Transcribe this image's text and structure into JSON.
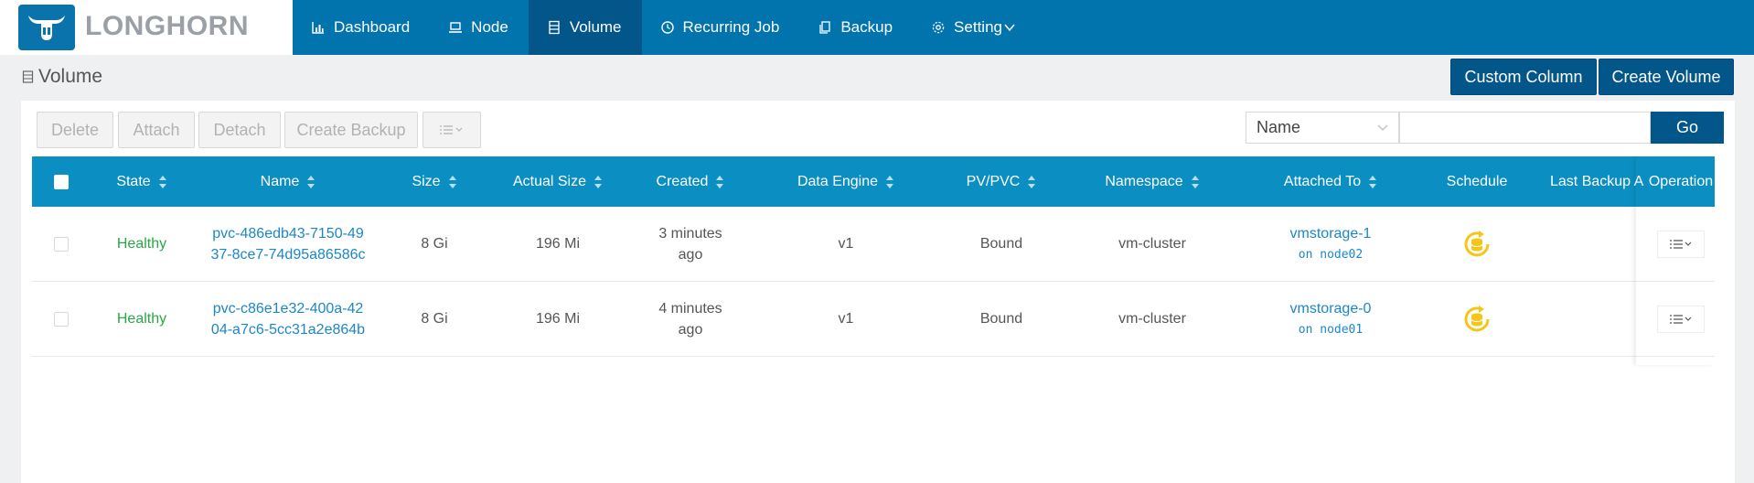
{
  "brand": {
    "name": "LONGHORN"
  },
  "nav": {
    "items": [
      {
        "label": "Dashboard",
        "icon": "bar-chart-icon"
      },
      {
        "label": "Node",
        "icon": "laptop-icon"
      },
      {
        "label": "Volume",
        "icon": "database-icon",
        "active": true
      },
      {
        "label": "Recurring Job",
        "icon": "clock-icon"
      },
      {
        "label": "Backup",
        "icon": "copy-icon"
      },
      {
        "label": "Setting",
        "icon": "gear-icon"
      }
    ]
  },
  "page": {
    "title": "Volume"
  },
  "actions": {
    "custom_column": "Custom Column",
    "create_volume": "Create Volume"
  },
  "toolbar": {
    "delete": "Delete",
    "attach": "Attach",
    "detach": "Detach",
    "create_backup": "Create Backup",
    "search_field": "Name",
    "search_value": "",
    "go": "Go"
  },
  "table": {
    "columns": [
      "State",
      "Name",
      "Size",
      "Actual Size",
      "Created",
      "Data Engine",
      "PV/PVC",
      "Namespace",
      "Attached To",
      "Schedule",
      "Last Backup A",
      "Operation"
    ],
    "rows": [
      {
        "state": "Healthy",
        "name_line1": "pvc-486edb43-7150-49",
        "name_line2": "37-8ce7-74d95a86586c",
        "size": "8 Gi",
        "actual_size": "196 Mi",
        "created_line1": "3 minutes",
        "created_line2": "ago",
        "engine": "v1",
        "pv": "Bound",
        "namespace": "vm-cluster",
        "attached": "vmstorage-1",
        "node": "on node02",
        "last_backup": ""
      },
      {
        "state": "Healthy",
        "name_line1": "pvc-c86e1e32-400a-42",
        "name_line2": "04-a7c6-5cc31a2e864b",
        "size": "8 Gi",
        "actual_size": "196 Mi",
        "created_line1": "4 minutes",
        "created_line2": "ago",
        "engine": "v1",
        "pv": "Bound",
        "namespace": "vm-cluster",
        "attached": "vmstorage-0",
        "node": "on node01",
        "last_backup": ""
      }
    ]
  },
  "colors": {
    "nav_bg": "#0274ad",
    "nav_active": "#03568a",
    "table_header": "#0b8fc2",
    "healthy": "#27a745",
    "link": "#1b87c9",
    "schedule_icon": "#f5c518"
  }
}
